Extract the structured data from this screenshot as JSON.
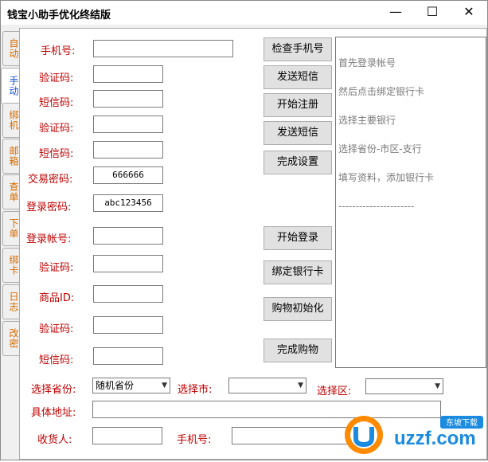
{
  "window": {
    "title": "钱宝小助手优化终结版",
    "min": "—",
    "max": "☐",
    "close": "✕"
  },
  "tabs": [
    {
      "label": "自动",
      "active": false
    },
    {
      "label": "手动",
      "active": true
    },
    {
      "label": "绑机",
      "active": false
    },
    {
      "label": "邮箱",
      "active": false
    },
    {
      "label": "查单",
      "active": false
    },
    {
      "label": "下单",
      "active": false
    },
    {
      "label": "绑卡",
      "active": false
    },
    {
      "label": "日志",
      "active": false
    },
    {
      "label": "改密",
      "active": false
    }
  ],
  "form": {
    "phone_label": "手机号:",
    "verify1_label": "验证码:",
    "sms1_label": "短信码:",
    "verify2_label": "验证码:",
    "sms2_label": "短信码:",
    "trade_pwd_label": "交易密码:",
    "trade_pwd_value": "666666",
    "login_pwd_label": "登录密码:",
    "login_pwd_value": "abc123456",
    "account_label": "登录帐号:",
    "verify3_label": "验证码:",
    "product_id_label": "商品ID:",
    "verify4_label": "验证码:",
    "sms3_label": "短信码:"
  },
  "buttons": {
    "check_phone": "检查手机号",
    "send_sms1": "发送短信",
    "start_register": "开始注册",
    "send_sms2": "发送短信",
    "finish_setup": "完成设置",
    "start_login": "开始登录",
    "bind_card": "绑定银行卡",
    "shop_init": "购物初始化",
    "finish_purchase": "完成购物"
  },
  "log": {
    "lines": [
      "首先登录帐号",
      "然后点击绑定银行卡",
      "选择主要银行",
      "选择省份-市区-支行",
      "填写资料，添加银行卡",
      "----------------------"
    ]
  },
  "address": {
    "province_label": "选择省份:",
    "province_value": "随机省份",
    "city_label": "选择市:",
    "city_value": "",
    "district_label": "选择区:",
    "district_value": "",
    "detail_label": "具体地址:",
    "receiver_label": "收货人:",
    "phone_label": "手机号:"
  },
  "watermark": {
    "brand": "uzzf.com",
    "tagline": "东坡下载"
  },
  "colors": {
    "label": "#c00000",
    "tab_text": "#d66b00",
    "tab_active": "#1b4fd6",
    "log_text": "#7a7a7a"
  }
}
